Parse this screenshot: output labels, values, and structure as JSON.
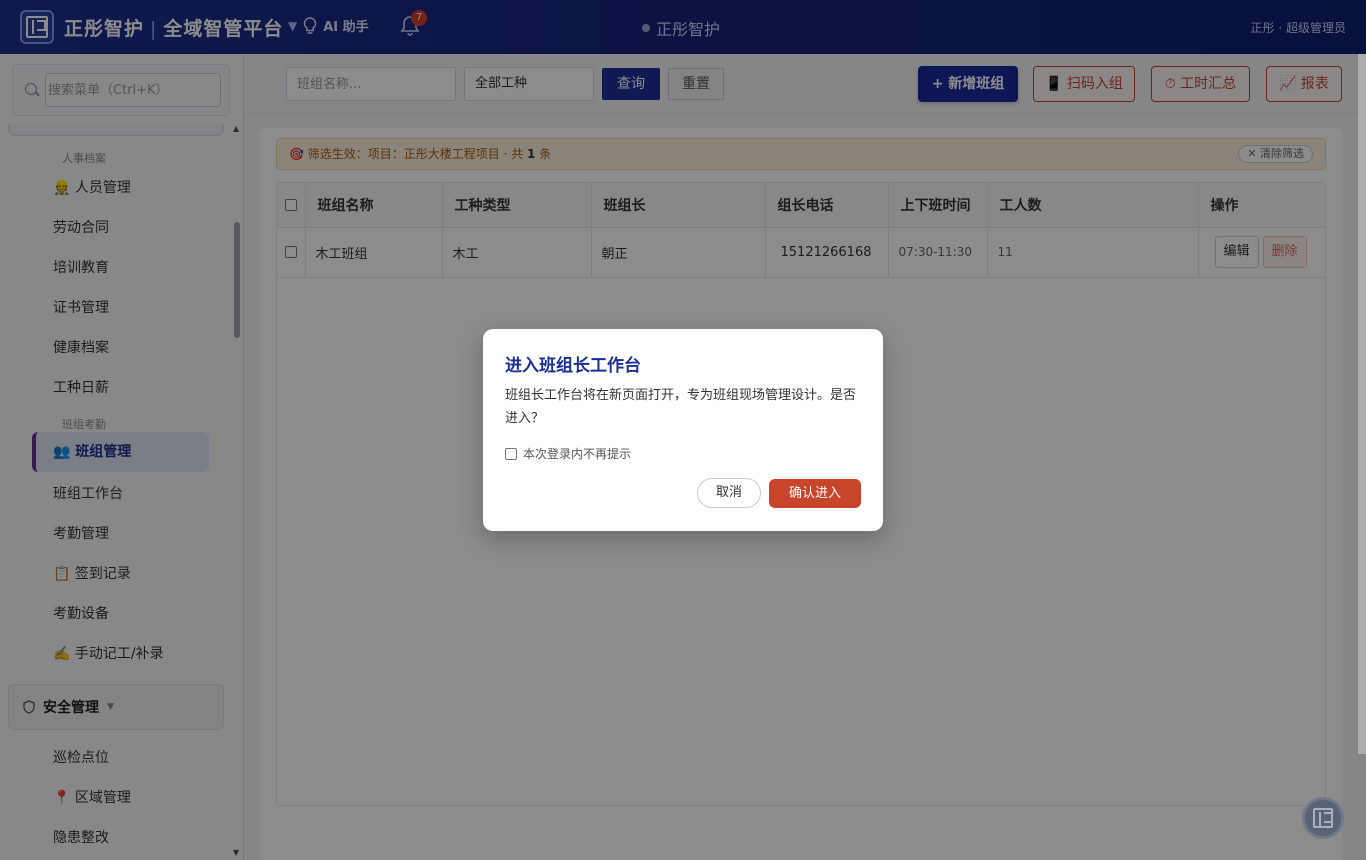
{
  "header": {
    "brand_name": "正彤智护",
    "platform_name": "全域智管平台",
    "ai_label": "AI 助手",
    "notification_count": "7",
    "center_title": "正彤智护",
    "user": "正彤 · 超级管理员"
  },
  "sidebar": {
    "search_placeholder": "搜索菜单（Ctrl+K）",
    "section_hr": "人事档案",
    "items_hr": [
      "👷 人员管理",
      "劳动合同",
      "培训教育",
      "证书管理",
      "健康档案",
      "工种日薪"
    ],
    "section_team": "班组考勤",
    "items_team": [
      "👥 班组管理",
      "班组工作台",
      "考勤管理",
      "📋 签到记录",
      "考勤设备",
      "✍️ 手动记工/补录"
    ],
    "group_safety": "安全管理",
    "items_safety": [
      "巡检点位",
      "📍 区域管理",
      "隐患整改"
    ]
  },
  "toolbar": {
    "name_placeholder": "班组名称...",
    "worktype_value": "全部工种",
    "query_label": "查询",
    "reset_label": "重置",
    "add_label": "+ 新增班组",
    "scan_label": "📱 扫码入组",
    "hours_label": "⏱ 工时汇总",
    "report_label": "📈 报表"
  },
  "filter": {
    "prefix": "🎯 筛选生效：项目：正彤大楼工程项目 · 共 ",
    "count": "1",
    "suffix": " 条",
    "clear_label": "✕ 清除筛选"
  },
  "table": {
    "columns": [
      "班组名称",
      "工种类型",
      "班组长",
      "组长电话",
      "上下班时间",
      "工人数",
      "操作"
    ],
    "rows": [
      {
        "name": "木工班组",
        "type": "木工",
        "leader": "朝正",
        "phone": "15121266168",
        "time": "07:30-11:30",
        "workers": "11",
        "edit": "编辑",
        "delete": "删除"
      }
    ]
  },
  "modal": {
    "title": "进入班组长工作台",
    "body": "班组长工作台将在新页面打开，专为班组现场管理设计。是否进入？",
    "checkbox_label": "本次登录内不再提示",
    "cancel_label": "取消",
    "confirm_label": "确认进入"
  }
}
